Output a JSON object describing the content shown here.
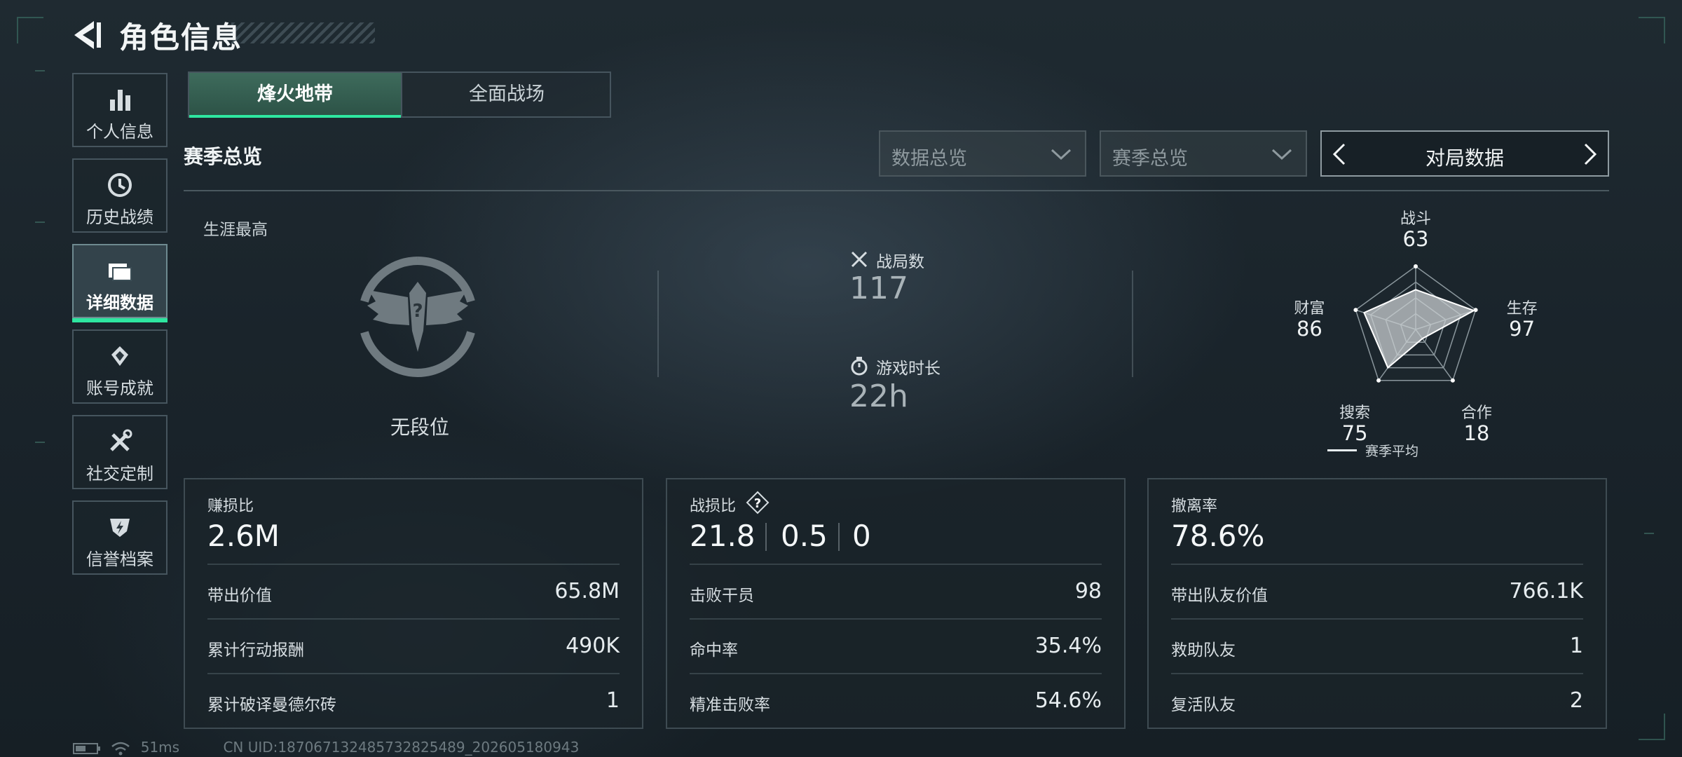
{
  "header": {
    "title": "角色信息"
  },
  "sidebar": {
    "items": [
      {
        "label": "个人信息"
      },
      {
        "label": "历史战绩"
      },
      {
        "label": "详细数据"
      },
      {
        "label": "账号成就"
      },
      {
        "label": "社交定制"
      },
      {
        "label": "信誉档案"
      }
    ],
    "active_index": 2
  },
  "tabs": [
    {
      "label": "烽火地带"
    },
    {
      "label": "全面战场"
    }
  ],
  "section": {
    "title": "赛季总览",
    "dropdown_1": "数据总览",
    "dropdown_2": "赛季总览",
    "pager_label": "对局数据"
  },
  "overview": {
    "career_label": "生涯最高",
    "rank_name": "无段位",
    "matches_label": "战局数",
    "matches_value": "117",
    "playtime_label": "游戏时长",
    "playtime_value": "22h"
  },
  "radar": {
    "axes": [
      {
        "label": "战斗",
        "value": 63
      },
      {
        "label": "生存",
        "value": 97
      },
      {
        "label": "合作",
        "value": 18
      },
      {
        "label": "搜索",
        "value": 75
      },
      {
        "label": "财富",
        "value": 86
      }
    ],
    "legend": "赛季平均"
  },
  "panels": {
    "profit": {
      "title": "赚损比",
      "main": "2.6M",
      "rows": [
        {
          "k": "带出价值",
          "v": "65.8M"
        },
        {
          "k": "累计行动报酬",
          "v": "490K"
        },
        {
          "k": "累计破译曼德尔砖",
          "v": "1"
        }
      ]
    },
    "kd": {
      "title": "战损比",
      "help": "?",
      "main_a": "21.8",
      "main_b": "0.5",
      "main_c": "0",
      "rows": [
        {
          "k": "击败干员",
          "v": "98"
        },
        {
          "k": "命中率",
          "v": "35.4%"
        },
        {
          "k": "精准击败率",
          "v": "54.6%"
        }
      ]
    },
    "extract": {
      "title": "撤离率",
      "main": "78.6%",
      "rows": [
        {
          "k": "带出队友价值",
          "v": "766.1K"
        },
        {
          "k": "救助队友",
          "v": "1"
        },
        {
          "k": "复活队友",
          "v": "2"
        }
      ]
    }
  },
  "footer": {
    "ping": "51ms",
    "uid": "CN UID:187067132485732825489_202605180943"
  },
  "colors": {
    "accent": "#2ee6a0",
    "panel_border": "#3e4b52"
  }
}
